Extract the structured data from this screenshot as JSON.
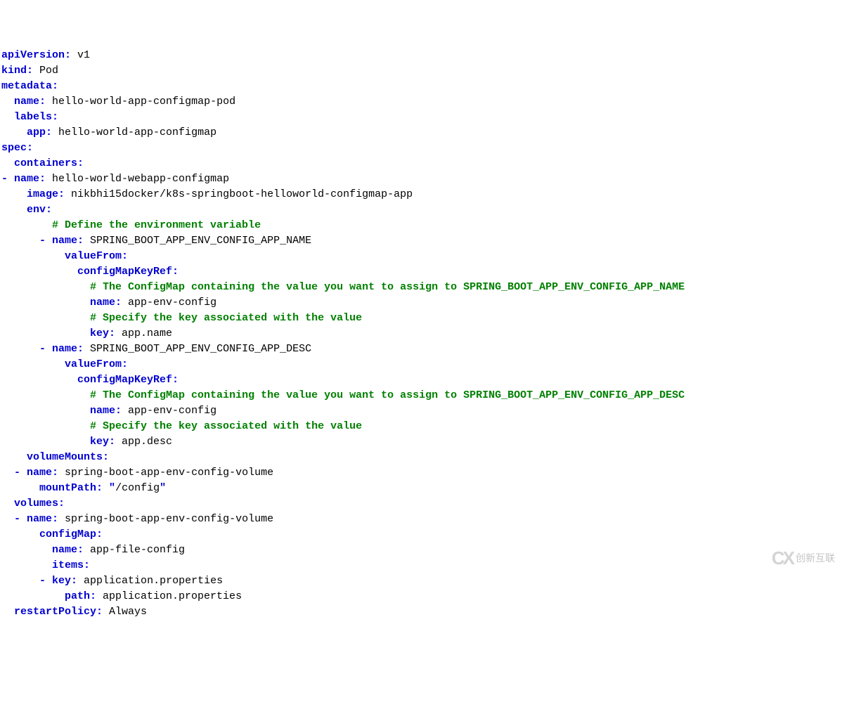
{
  "lines": [
    {
      "indent": 0,
      "segments": [
        {
          "t": "key",
          "v": "apiVersion:"
        },
        {
          "t": "plain",
          "v": " v1"
        }
      ]
    },
    {
      "indent": 0,
      "segments": [
        {
          "t": "key",
          "v": "kind:"
        },
        {
          "t": "plain",
          "v": " Pod"
        }
      ]
    },
    {
      "indent": 0,
      "segments": [
        {
          "t": "key",
          "v": "metadata:"
        }
      ]
    },
    {
      "indent": 1,
      "segments": [
        {
          "t": "key",
          "v": "name:"
        },
        {
          "t": "plain",
          "v": " hello-world-app-configmap-pod"
        }
      ]
    },
    {
      "indent": 1,
      "segments": [
        {
          "t": "key",
          "v": "labels:"
        }
      ]
    },
    {
      "indent": 2,
      "segments": [
        {
          "t": "key",
          "v": "app:"
        },
        {
          "t": "plain",
          "v": " hello-world-app-configmap"
        }
      ]
    },
    {
      "indent": 0,
      "segments": [
        {
          "t": "key",
          "v": "spec:"
        }
      ]
    },
    {
      "indent": 1,
      "segments": [
        {
          "t": "key",
          "v": "containers:"
        }
      ]
    },
    {
      "indent": 1,
      "dash": true,
      "segments": [
        {
          "t": "key",
          "v": "name:"
        },
        {
          "t": "plain",
          "v": " hello-world-webapp-configmap"
        }
      ]
    },
    {
      "indent": 2,
      "segments": [
        {
          "t": "key",
          "v": "image:"
        },
        {
          "t": "plain",
          "v": " nikbhi15docker/k8s-springboot-helloworld-configmap-app"
        }
      ]
    },
    {
      "indent": 2,
      "segments": [
        {
          "t": "key",
          "v": "env:"
        }
      ]
    },
    {
      "indent": 4,
      "segments": [
        {
          "t": "comment",
          "v": "# Define the environment variable"
        }
      ]
    },
    {
      "indent": 4,
      "dash": true,
      "segments": [
        {
          "t": "key",
          "v": "name:"
        },
        {
          "t": "plain",
          "v": " SPRING_BOOT_APP_ENV_CONFIG_APP_NAME"
        }
      ]
    },
    {
      "indent": 5,
      "segments": [
        {
          "t": "key",
          "v": "valueFrom:"
        }
      ]
    },
    {
      "indent": 6,
      "segments": [
        {
          "t": "key",
          "v": "configMapKeyRef:"
        }
      ]
    },
    {
      "indent": 7,
      "segments": [
        {
          "t": "comment",
          "v": "# The ConfigMap containing the value you want to assign to SPRING_BOOT_APP_ENV_CONFIG_APP_NAME"
        }
      ]
    },
    {
      "indent": 7,
      "segments": [
        {
          "t": "key",
          "v": "name:"
        },
        {
          "t": "plain",
          "v": " app-env-config"
        }
      ]
    },
    {
      "indent": 7,
      "segments": [
        {
          "t": "comment",
          "v": "# Specify the key associated with the value"
        }
      ]
    },
    {
      "indent": 7,
      "segments": [
        {
          "t": "key",
          "v": "key:"
        },
        {
          "t": "plain",
          "v": " app.name"
        }
      ]
    },
    {
      "indent": 4,
      "dash": true,
      "segments": [
        {
          "t": "key",
          "v": "name:"
        },
        {
          "t": "plain",
          "v": " SPRING_BOOT_APP_ENV_CONFIG_APP_DESC"
        }
      ]
    },
    {
      "indent": 5,
      "segments": [
        {
          "t": "key",
          "v": "valueFrom:"
        }
      ]
    },
    {
      "indent": 6,
      "segments": [
        {
          "t": "key",
          "v": "configMapKeyRef:"
        }
      ]
    },
    {
      "indent": 7,
      "segments": [
        {
          "t": "comment",
          "v": "# The ConfigMap containing the value you want to assign to SPRING_BOOT_APP_ENV_CONFIG_APP_DESC"
        }
      ]
    },
    {
      "indent": 7,
      "segments": [
        {
          "t": "key",
          "v": "name:"
        },
        {
          "t": "plain",
          "v": " app-env-config"
        }
      ]
    },
    {
      "indent": 7,
      "segments": [
        {
          "t": "comment",
          "v": "# Specify the key associated with the value"
        }
      ]
    },
    {
      "indent": 7,
      "segments": [
        {
          "t": "key",
          "v": "key:"
        },
        {
          "t": "plain",
          "v": " app.desc"
        }
      ]
    },
    {
      "indent": 2,
      "segments": [
        {
          "t": "key",
          "v": "volumeMounts:"
        }
      ]
    },
    {
      "indent": 2,
      "dash": true,
      "segments": [
        {
          "t": "key",
          "v": "name:"
        },
        {
          "t": "plain",
          "v": " spring-boot-app-env-config-volume"
        }
      ]
    },
    {
      "indent": 3,
      "segments": [
        {
          "t": "key",
          "v": "mountPath:"
        },
        {
          "t": "plain",
          "v": " "
        },
        {
          "t": "key",
          "v": "\""
        },
        {
          "t": "plain",
          "v": "/config"
        },
        {
          "t": "key",
          "v": "\""
        }
      ]
    },
    {
      "indent": 1,
      "segments": [
        {
          "t": "key",
          "v": "volumes:"
        }
      ]
    },
    {
      "indent": 2,
      "dash": true,
      "segments": [
        {
          "t": "key",
          "v": "name:"
        },
        {
          "t": "plain",
          "v": " spring-boot-app-env-config-volume"
        }
      ]
    },
    {
      "indent": 3,
      "segments": [
        {
          "t": "key",
          "v": "configMap:"
        }
      ]
    },
    {
      "indent": 4,
      "segments": [
        {
          "t": "key",
          "v": "name:"
        },
        {
          "t": "plain",
          "v": " app-file-config"
        }
      ]
    },
    {
      "indent": 4,
      "segments": [
        {
          "t": "key",
          "v": "items:"
        }
      ]
    },
    {
      "indent": 4,
      "dash": true,
      "segments": [
        {
          "t": "key",
          "v": "key:"
        },
        {
          "t": "plain",
          "v": " application.properties"
        }
      ]
    },
    {
      "indent": 5,
      "segments": [
        {
          "t": "key",
          "v": "path:"
        },
        {
          "t": "plain",
          "v": " application.properties"
        }
      ]
    },
    {
      "indent": 1,
      "segments": [
        {
          "t": "key",
          "v": "restartPolicy:"
        },
        {
          "t": "plain",
          "v": " Always"
        }
      ]
    }
  ],
  "watermark": "创新互联"
}
